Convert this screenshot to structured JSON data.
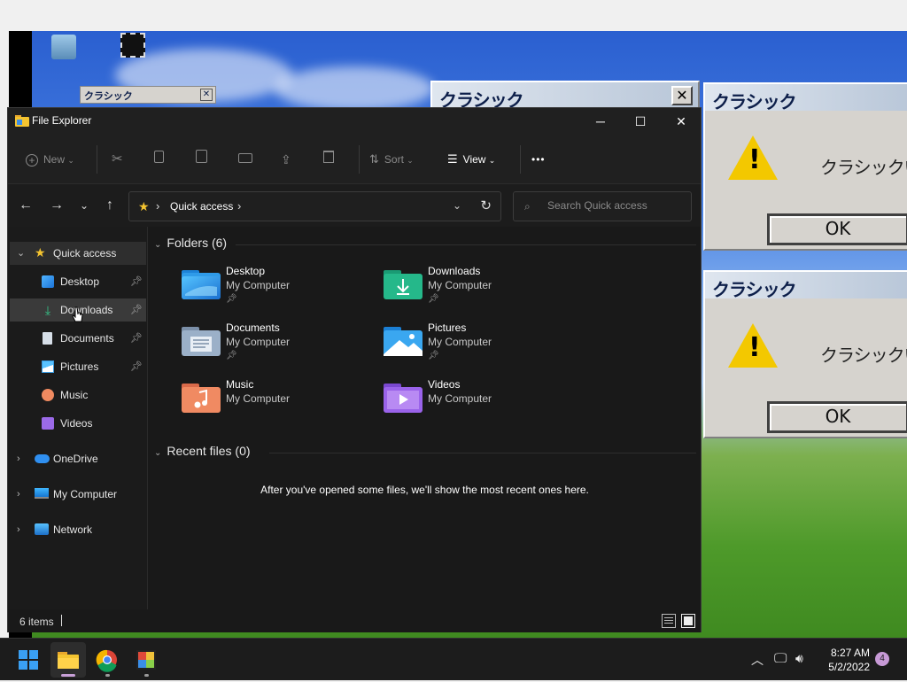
{
  "window": {
    "title": "File Explorer",
    "controls": {
      "minimize": "─",
      "maximize": "☐",
      "close": "✕"
    }
  },
  "toolbar": {
    "new_label": "New",
    "sort_label": "Sort",
    "view_label": "View",
    "more_label": "•••"
  },
  "address": {
    "crumb": "Quick access",
    "search_placeholder": "Search Quick access"
  },
  "sidebar": {
    "quick_access": "Quick access",
    "items": [
      {
        "label": "Desktop",
        "pinned": true
      },
      {
        "label": "Downloads",
        "pinned": true
      },
      {
        "label": "Documents",
        "pinned": true
      },
      {
        "label": "Pictures",
        "pinned": true
      },
      {
        "label": "Music",
        "pinned": false
      },
      {
        "label": "Videos",
        "pinned": false
      }
    ],
    "onedrive": "OneDrive",
    "my_computer": "My Computer",
    "network": "Network"
  },
  "folders": {
    "header": "Folders (6)",
    "items": [
      {
        "name": "Desktop",
        "location": "My Computer",
        "pinned": true
      },
      {
        "name": "Downloads",
        "location": "My Computer",
        "pinned": true
      },
      {
        "name": "Documents",
        "location": "My Computer",
        "pinned": true
      },
      {
        "name": "Pictures",
        "location": "My Computer",
        "pinned": true
      },
      {
        "name": "Music",
        "location": "My Computer",
        "pinned": false
      },
      {
        "name": "Videos",
        "location": "My Computer",
        "pinned": false
      }
    ]
  },
  "recent": {
    "header": "Recent files (0)",
    "empty_message": "After you've opened some files, we'll show the most recent ones here."
  },
  "status": {
    "item_count": "6 items"
  },
  "background": {
    "dialog_title": "クラシック",
    "dialog_message": "クラシックい",
    "ok_label": "OK",
    "mini_title": "クラシック"
  },
  "taskbar": {
    "time": "8:27 AM",
    "date": "5/2/2022",
    "notification_count": "4"
  },
  "colors": {
    "accent": "#f4c430",
    "window_bg": "#191919",
    "taskbar_bg": "#1c1c1c"
  }
}
